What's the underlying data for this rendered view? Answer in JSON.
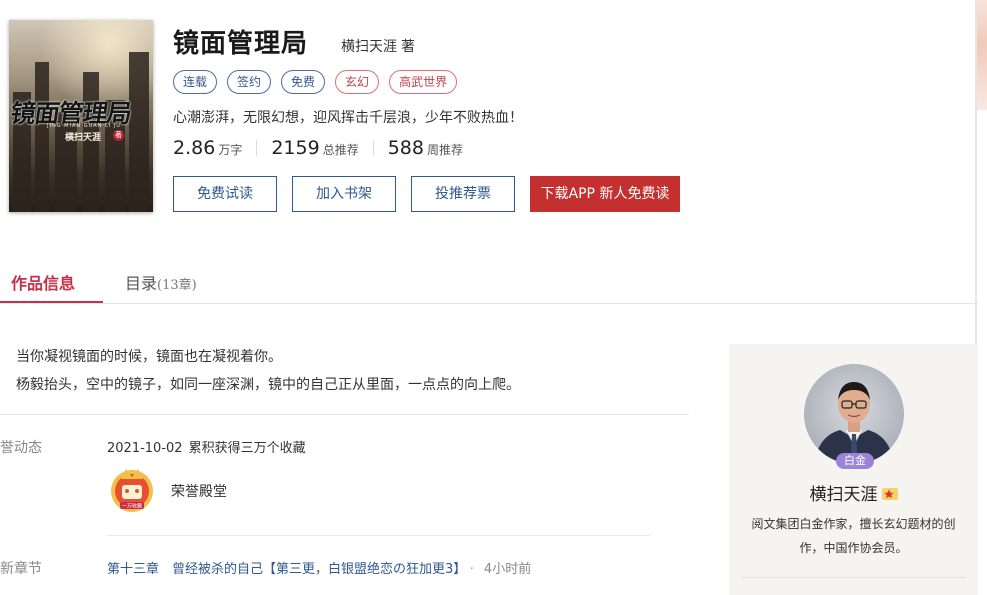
{
  "book": {
    "title": "镜面管理局",
    "author": "横扫天涯",
    "author_role": "著",
    "cover": {
      "title": "镜面管理局",
      "author": "横扫天涯",
      "pinyin": "JING MIAN GUAN LI JU",
      "seal": "著"
    },
    "tags": [
      {
        "label": "连载",
        "style": "blue"
      },
      {
        "label": "签约",
        "style": "blue"
      },
      {
        "label": "免费",
        "style": "blue"
      },
      {
        "label": "玄幻",
        "style": "red"
      },
      {
        "label": "高武世界",
        "style": "red"
      }
    ],
    "slogan": "心潮澎湃，无限幻想，迎风挥击千层浪，少年不败热血！",
    "stats": [
      {
        "value": "2.86",
        "unit": "万字"
      },
      {
        "value": "2159",
        "unit": "总推荐"
      },
      {
        "value": "588",
        "unit": "周推荐"
      }
    ],
    "actions": {
      "free_read": "免费试读",
      "add_shelf": "加入书架",
      "vote": "投推荐票",
      "download": "下载APP 新人免费读"
    }
  },
  "tabs": {
    "info": "作品信息",
    "catalog": "目录",
    "catalog_count": "(13章)"
  },
  "intro": {
    "line1": "当你凝视镜面的时候，镜面也在凝视着你。",
    "line2": "杨毅抬头，空中的镜子，如同一座深渊，镜中的自己正从里面，一点点的向上爬。"
  },
  "honor": {
    "label": "荣誉动态",
    "date": "2021-10-02",
    "text": "累积获得三万个收藏",
    "badge_label": "荣誉殿堂",
    "badge_caption": "一万收藏"
  },
  "latest": {
    "label": "最新章节",
    "chapter": "第十三章　曾经被杀的自己【第三更，白银盟绝恋の狂加更3】",
    "dot": "·",
    "time": "4小时前"
  },
  "author_card": {
    "level": "白金",
    "name": "横扫天涯",
    "description": "阅文集团白金作家，擅长玄幻题材的创作，中国作协会员。"
  },
  "colors": {
    "accent_red": "#c8304a",
    "link_blue": "#2f5990",
    "download_bg": "#c43030",
    "level_badge": "#9b83d8"
  }
}
